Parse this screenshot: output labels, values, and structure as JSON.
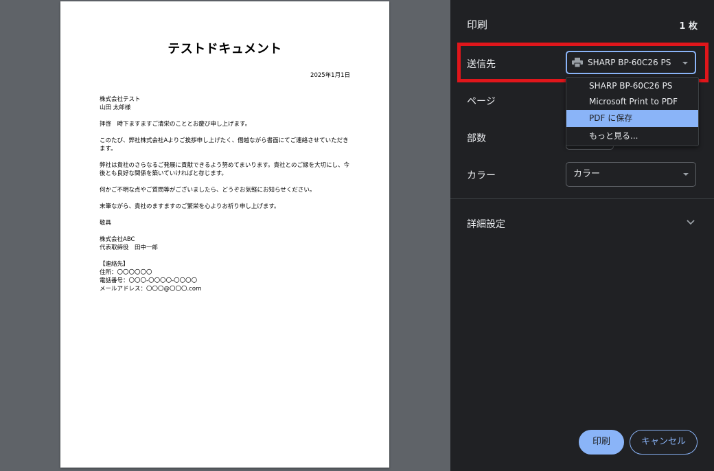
{
  "document": {
    "title": "テストドキュメント",
    "date": "2025年1月1日",
    "paragraphs": [
      "株式会社テスト\n山田 太郎様",
      "拝啓　時下ますますご清栄のこととお慶び申し上げます。",
      "このたび、弊社株式会社Aよりご挨拶申し上げたく、僭越ながら書面にてご連絡させていただきます。",
      "弊社は貴社のさらなるご発展に貢献できるよう努めてまいります。貴社とのご縁を大切にし、今後とも良好な関係を築いていければと存じます。",
      "何かご不明な点やご質問等がございましたら、どうぞお気軽にお知らせください。",
      "末筆ながら、貴社のますますのご繁栄を心よりお祈り申し上げます。",
      "敬具",
      "株式会社ABC\n代表取締役　田中一郎",
      "【連絡先】\n住所：〇〇〇〇〇〇\n電話番号：〇〇〇-〇〇〇〇-〇〇〇〇\nメールアドレス：〇〇〇@〇〇〇.com"
    ]
  },
  "panel": {
    "title": "印刷",
    "sheet_count": "1 枚",
    "destination": {
      "label": "送信先",
      "value": "SHARP BP-60C26 PS",
      "options": [
        "SHARP BP-60C26 PS",
        "Microsoft Print to PDF",
        "PDF に保存",
        "もっと見る..."
      ],
      "selected_option_index": 2
    },
    "pages": {
      "label": "ページ"
    },
    "copies": {
      "label": "部数"
    },
    "color": {
      "label": "カラー",
      "value": "カラー"
    },
    "advanced": {
      "label": "詳細設定"
    },
    "buttons": {
      "print": "印刷",
      "cancel": "キャンセル"
    }
  },
  "colors": {
    "accent": "#8ab4f8",
    "highlight": "#e0161b",
    "panel_bg": "#202124",
    "preview_bg": "#5f6368"
  }
}
